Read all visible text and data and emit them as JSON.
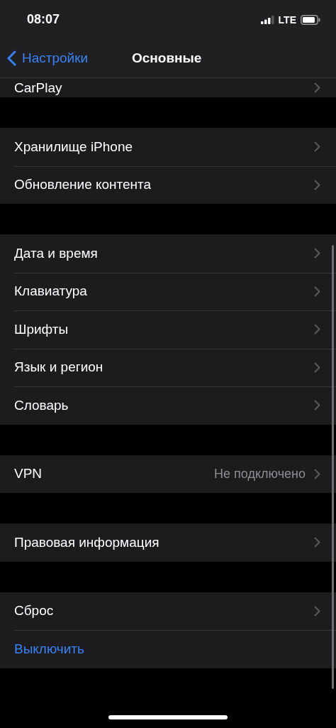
{
  "status_bar": {
    "time": "08:07",
    "network": "LTE"
  },
  "nav_bar": {
    "back": "Настройки",
    "title": "Основные"
  },
  "sections": [
    {
      "partial": true,
      "rows": [
        {
          "label": "CarPlay",
          "kind": "link"
        }
      ]
    },
    {
      "rows": [
        {
          "label": "Хранилище iPhone",
          "kind": "link"
        },
        {
          "label": "Обновление контента",
          "kind": "link"
        }
      ]
    },
    {
      "rows": [
        {
          "label": "Дата и время",
          "kind": "link"
        },
        {
          "label": "Клавиатура",
          "kind": "link"
        },
        {
          "label": "Шрифты",
          "kind": "link"
        },
        {
          "label": "Язык и регион",
          "kind": "link"
        },
        {
          "label": "Словарь",
          "kind": "link"
        }
      ]
    },
    {
      "rows": [
        {
          "label": "VPN",
          "kind": "link",
          "value": "Не подключено"
        }
      ]
    },
    {
      "rows": [
        {
          "label": "Правовая информация",
          "kind": "link"
        }
      ]
    },
    {
      "rows": [
        {
          "label": "Сброс",
          "kind": "link"
        },
        {
          "label": "Выключить",
          "kind": "action"
        }
      ]
    }
  ]
}
